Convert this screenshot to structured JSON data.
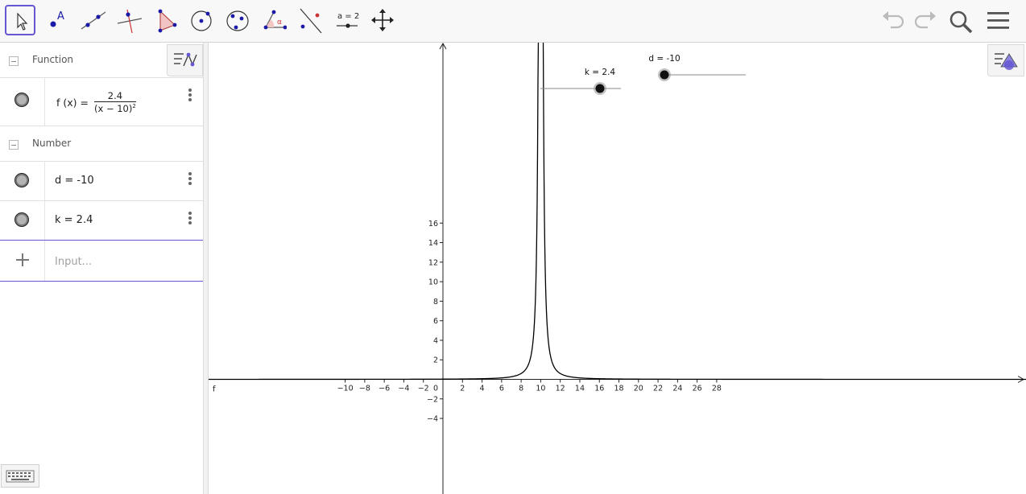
{
  "toolbar": {
    "tools": [
      {
        "name": "move-tool-icon"
      },
      {
        "name": "point-tool-icon",
        "label": "A"
      },
      {
        "name": "line-tool-icon"
      },
      {
        "name": "perpendicular-line-tool-icon"
      },
      {
        "name": "polygon-tool-icon"
      },
      {
        "name": "circle-center-point-tool-icon"
      },
      {
        "name": "circle-three-points-tool-icon"
      },
      {
        "name": "angle-tool-icon",
        "label": "α"
      },
      {
        "name": "reflect-tool-icon"
      },
      {
        "name": "slider-tool-icon",
        "label": "a = 2"
      },
      {
        "name": "move-graphics-view-tool-icon"
      }
    ],
    "right": [
      "undo-icon",
      "redo-icon",
      "search-icon",
      "menu-icon"
    ]
  },
  "algebra": {
    "categories": {
      "function": "Function",
      "number": "Number"
    },
    "function_row": {
      "lhs": "f (x)  =",
      "numerator": "2.4",
      "denominator": "(x − 10)",
      "exponent": "2"
    },
    "number_rows": [
      {
        "text": "d  =  -10"
      },
      {
        "text": "k  =  2.4"
      }
    ],
    "input_placeholder": "Input..."
  },
  "graphics": {
    "axis_label": "f",
    "x_ticks": [
      -10,
      -8,
      -6,
      -4,
      -2,
      0,
      2,
      4,
      6,
      8,
      10,
      12,
      14,
      16,
      18,
      20,
      22,
      24,
      26,
      28
    ],
    "y_ticks": [
      -4,
      -2,
      2,
      4,
      6,
      8,
      10,
      12,
      14,
      16
    ],
    "sliders": [
      {
        "label": "k = 2.4",
        "value": 2.4,
        "min": -5,
        "max": 5
      },
      {
        "label": "d = -10",
        "value": -10,
        "min": -10,
        "max": 10
      }
    ],
    "curve": {
      "k": 2.4,
      "d": -10
    },
    "colors": {
      "accent": "#6557d2",
      "axis": "#222222",
      "curve": "#000000"
    }
  }
}
